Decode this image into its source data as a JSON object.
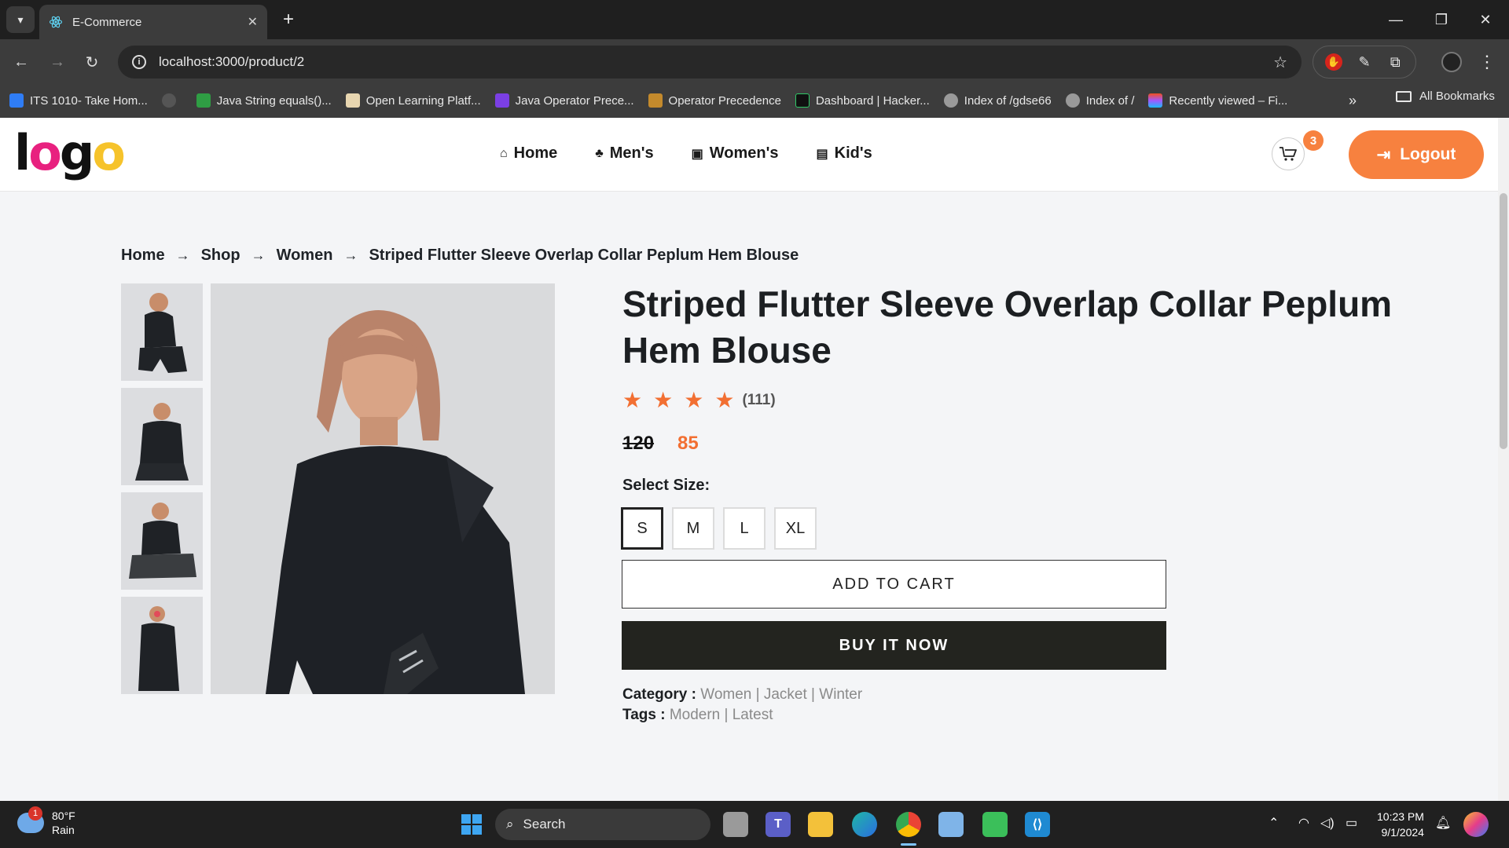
{
  "browser": {
    "tab_title": "E-Commerce",
    "url": "localhost:3000/product/2",
    "bookmarks": [
      "ITS 1010- Take Hom...",
      "",
      "Java String equals()...",
      "Open Learning Platf...",
      "Java Operator Prece...",
      "Operator Precedence",
      "Dashboard | Hacker...",
      "Index of /gdse66",
      "Index of /",
      "Recently viewed – Fi..."
    ],
    "all_bookmarks_label": "All Bookmarks",
    "more_label": "»"
  },
  "header": {
    "logo_text": "logo",
    "nav": [
      {
        "label": "Home",
        "icon": "home-icon"
      },
      {
        "label": "Men's",
        "icon": "men-icon"
      },
      {
        "label": "Women's",
        "icon": "women-icon"
      },
      {
        "label": "Kid's",
        "icon": "kids-icon"
      }
    ],
    "cart_count": "3",
    "logout_label": "Logout",
    "accent_color": "#f7813f"
  },
  "breadcrumb": [
    "Home",
    "Shop",
    "Women",
    "Striped Flutter Sleeve Overlap Collar Peplum Hem Blouse"
  ],
  "product": {
    "title": "Striped Flutter Sleeve Overlap Collar Peplum Hem Blouse",
    "rating_stars": 4,
    "review_count": "(111)",
    "old_price": "120",
    "new_price": "85",
    "select_size_label": "Select Size:",
    "sizes": [
      "S",
      "M",
      "L",
      "XL"
    ],
    "selected_size": "S",
    "add_to_cart_label": "ADD TO CART",
    "buy_now_label": "BUY IT NOW",
    "category_label": "Category :",
    "category_value": "Women | Jacket | Winter",
    "tags_label": "Tags :",
    "tags_value": "Modern | Latest",
    "thumbnail_count": 4
  },
  "taskbar": {
    "temperature": "80°F",
    "weather": "Rain",
    "weather_badge": "1",
    "search_placeholder": "Search",
    "time": "10:23 PM",
    "date": "9/1/2024"
  }
}
